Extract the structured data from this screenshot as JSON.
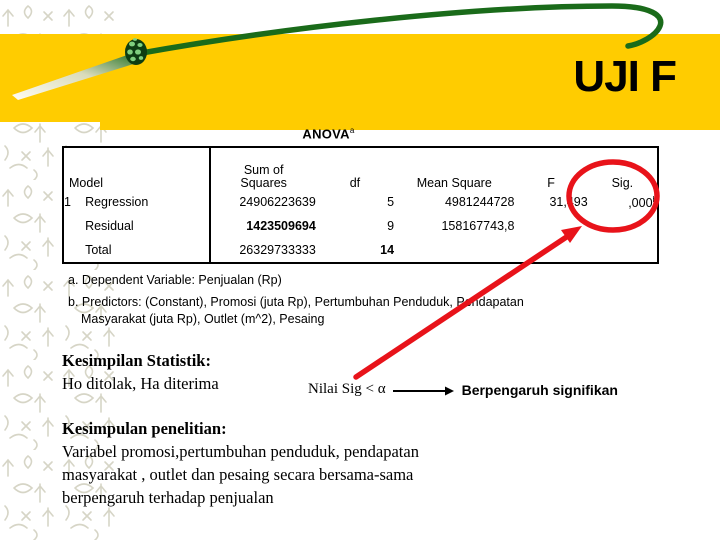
{
  "header": {
    "title": "UJI F",
    "band_color": "#ffcc00",
    "swoosh_color": "#1a6b1a",
    "globe_icon": "globe-icon"
  },
  "anova": {
    "caption": "ANOVA",
    "caption_superscript": "a",
    "columns": [
      {
        "label": "Model"
      },
      {
        "label": ""
      },
      {
        "label": "Sum of\nSquares",
        "line1": "Sum of",
        "line2": "Squares"
      },
      {
        "label": "df"
      },
      {
        "label": "Mean Square"
      },
      {
        "label": "F"
      },
      {
        "label": "Sig."
      }
    ],
    "rows": [
      {
        "model": "1",
        "source": "Regression",
        "sum_of_squares": "24906223639",
        "df": "5",
        "mean_square": "4981244728",
        "f": "31,493",
        "sig": ",000",
        "sig_superscript": "b"
      },
      {
        "model": "",
        "source": "Residual",
        "sum_of_squares": "1423509694",
        "df": "9",
        "mean_square": "158167743,8",
        "f": "",
        "sig": "",
        "sig_superscript": ""
      },
      {
        "model": "",
        "source": "Total",
        "sum_of_squares": "26329733333",
        "df": "14",
        "mean_square": "",
        "f": "",
        "sig": "",
        "sig_superscript": ""
      }
    ],
    "footnotes": [
      "a. Dependent Variable: Penjualan (Rp)",
      "b. Predictors: (Constant), Promosi (juta Rp), Pertumbuhan Penduduk, Pendapatan",
      "Masyarakat (juta Rp), Outlet (m^2), Pesaing"
    ]
  },
  "conclusions": {
    "statistik_heading": "Kesimpilan Statistik:",
    "statistik_body": "Ho ditolak, Ha diterima",
    "penelitian_heading": "Kesimpulan penelitian:",
    "penelitian_body_line1": "Variabel promosi,pertumbuhan penduduk, pendapatan",
    "penelitian_body_line2": "masyarakat , outlet dan pesaing secara bersama-sama",
    "penelitian_body_line3": "berpengaruh terhadap penjualan"
  },
  "sig_rule": {
    "condition": "Nilai Sig < α",
    "result": "Berpengaruh signifikan"
  },
  "annotations": {
    "highlight_color": "#e8131a",
    "circle_target": "sig-value-cell",
    "arrow_from": "kesimpulan-statistik",
    "arrow_to": "sig-value-cell"
  }
}
